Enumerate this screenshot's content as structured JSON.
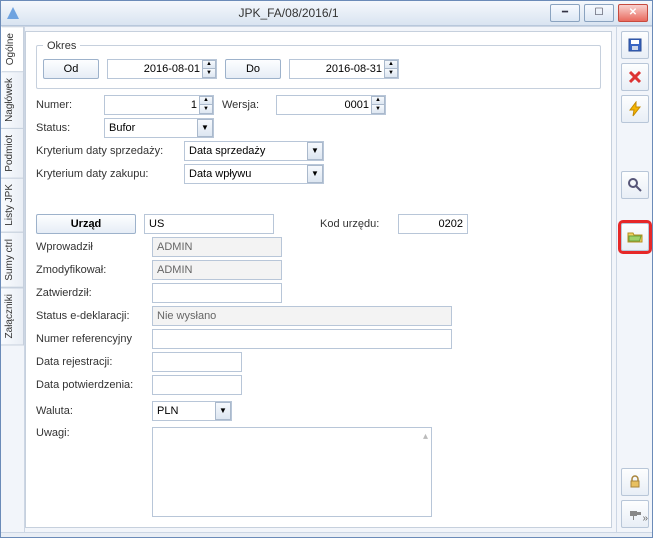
{
  "window": {
    "title": "JPK_FA/08/2016/1"
  },
  "tabs": {
    "t0": "Ogólne",
    "t1": "Nagłówek",
    "t2": "Podmiot",
    "t3": "Listy JPK",
    "t4": "Sumy ctrl",
    "t5": "Załączniki"
  },
  "okres": {
    "legend": "Okres",
    "od_btn": "Od",
    "od_value": "2016-08-01",
    "do_btn": "Do",
    "do_value": "2016-08-31"
  },
  "fields": {
    "numer_label": "Numer:",
    "numer_value": "1",
    "wersja_label": "Wersja:",
    "wersja_value": "0001",
    "status_label": "Status:",
    "status_value": "Bufor",
    "kryt_sprzedazy_label": "Kryterium daty sprzedaży:",
    "kryt_sprzedazy_value": "Data sprzedaży",
    "kryt_zakupu_label": "Kryterium daty zakupu:",
    "kryt_zakupu_value": "Data wpływu",
    "urzad_btn": "Urząd",
    "urzad_value": "US",
    "kod_urzedu_label": "Kod urzędu:",
    "kod_urzedu_value": "0202",
    "wprowadzil_label": "Wprowadził",
    "wprowadzil_value": "ADMIN",
    "zmodyfikowal_label": "Zmodyfikował:",
    "zmodyfikowal_value": "ADMIN",
    "zatwierdzil_label": "Zatwierdził:",
    "zatwierdzil_value": "",
    "status_edek_label": "Status e-deklaracji:",
    "status_edek_value": "Nie wysłano",
    "numer_ref_label": "Numer referencyjny",
    "numer_ref_value": "",
    "data_rej_label": "Data rejestracji:",
    "data_rej_value": "",
    "data_potw_label": "Data potwierdzenia:",
    "data_potw_value": "",
    "waluta_label": "Waluta:",
    "waluta_value": "PLN",
    "uwagi_label": "Uwagi:",
    "uwagi_value": ""
  },
  "icons": {
    "save": "save-icon",
    "delete": "delete-icon",
    "flash": "lightning-icon",
    "search": "magnifier-icon",
    "folder": "open-folder-icon",
    "lock": "lock-icon",
    "pin": "pin-icon"
  }
}
